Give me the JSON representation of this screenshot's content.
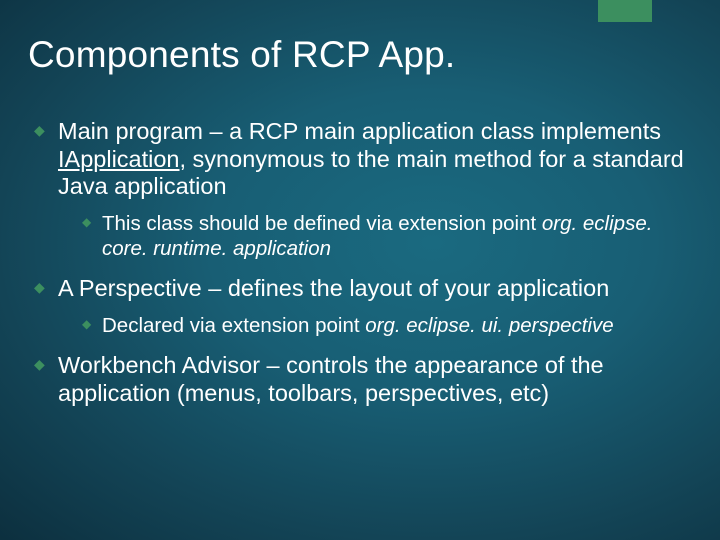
{
  "title": "Components of RCP App.",
  "bullets": {
    "b1": {
      "lead": "Main program – a RCP main application class implements ",
      "underlined": "IApplication",
      "tail": ", synonymous to the main method for a standard Java application",
      "sub": {
        "lead": "This class should be defined via extension point ",
        "italic": "org. eclipse. core. runtime. application"
      }
    },
    "b2": {
      "text": "A Perspective – defines the layout of your application",
      "sub": {
        "lead": "Declared via extension point ",
        "italic": "org. eclipse. ui. perspective"
      }
    },
    "b3": {
      "text": "Workbench Advisor – controls the appearance of the application (menus, toolbars, perspectives, etc)"
    }
  }
}
